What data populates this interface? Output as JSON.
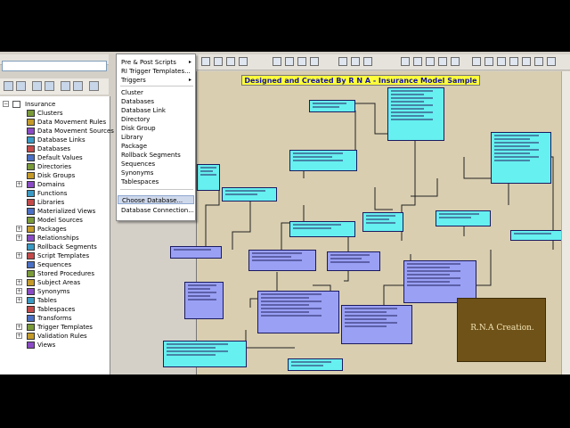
{
  "diagram_title": "Designed and Created By R N A - Insurance Model Sample",
  "watermark_text": "R.N.A Creation.",
  "tree": {
    "items": [
      {
        "label": "Insurance",
        "expander": "−",
        "root": true
      },
      {
        "label": "Clusters"
      },
      {
        "label": "Data Movement Rules"
      },
      {
        "label": "Data Movement Sources"
      },
      {
        "label": "Database Links"
      },
      {
        "label": "Databases"
      },
      {
        "label": "Default Values"
      },
      {
        "label": "Directories"
      },
      {
        "label": "Disk Groups"
      },
      {
        "label": "Domains",
        "expander": "+"
      },
      {
        "label": "Functions"
      },
      {
        "label": "Libraries"
      },
      {
        "label": "Materialized Views"
      },
      {
        "label": "Model Sources"
      },
      {
        "label": "Packages",
        "expander": "+"
      },
      {
        "label": "Relationships",
        "expander": "+"
      },
      {
        "label": "Rollback Segments"
      },
      {
        "label": "Script Templates",
        "expander": "+"
      },
      {
        "label": "Sequences"
      },
      {
        "label": "Stored Procedures"
      },
      {
        "label": "Subject Areas",
        "expander": "+"
      },
      {
        "label": "Synonyms",
        "expander": "+"
      },
      {
        "label": "Tables",
        "expander": "+"
      },
      {
        "label": "Tablespaces"
      },
      {
        "label": "Transforms"
      },
      {
        "label": "Trigger Templates",
        "expander": "+"
      },
      {
        "label": "Validation Rules",
        "expander": "+"
      },
      {
        "label": "Views"
      }
    ]
  },
  "menu": {
    "items": [
      {
        "label": "Pre & Post Scripts",
        "arrow": "▸"
      },
      {
        "label": "RI Trigger Templates...",
        "arrow": ""
      },
      {
        "label": "Triggers",
        "arrow": "▸"
      },
      {
        "label": "Cluster"
      },
      {
        "label": "Databases"
      },
      {
        "label": "Database Link"
      },
      {
        "label": "Directory"
      },
      {
        "label": "Disk Group"
      },
      {
        "label": "Library"
      },
      {
        "label": "Package"
      },
      {
        "label": "Rollback Segments"
      },
      {
        "label": "Sequences"
      },
      {
        "label": "Synonyms"
      },
      {
        "label": "Tablespaces"
      },
      {
        "label": "Choose Database...",
        "highlighted": true
      },
      {
        "label": "Database Connection..."
      }
    ]
  },
  "colors": {
    "canvas": "#d9ceb0",
    "entity_cyan": "#66f0f0",
    "entity_blue": "#9aa0f4",
    "title_bg": "#ffff3a",
    "title_text": "#1414a0"
  }
}
